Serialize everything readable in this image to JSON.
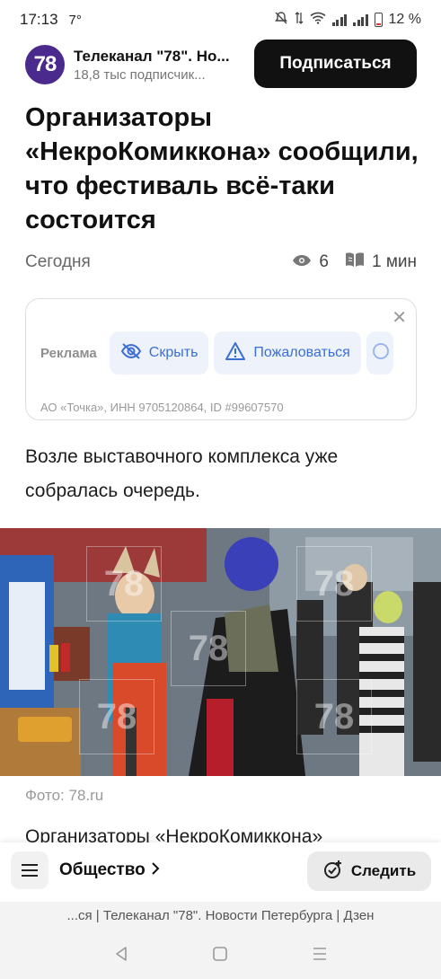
{
  "status_bar": {
    "time": "17:13",
    "temperature": "7°",
    "battery": "12 %"
  },
  "channel": {
    "logo_text": "78",
    "name": "Телеканал \"78\". Но...",
    "subscribers": "18,8 тыс подписчик...",
    "subscribe_label": "Подписаться"
  },
  "article": {
    "title": "Организаторы «НекроКомиккона» сообщили, что фестиваль всё-таки состоится",
    "date": "Сегодня",
    "views": "6",
    "read_time": "1 мин",
    "paragraph1": "Возле выставочного комплекса уже собралась очередь.",
    "photo_caption": "Фото: 78.ru",
    "paragraph2_cut": "Организаторы «НекроКомиккона»",
    "watermark": "78"
  },
  "ad": {
    "label": "Реклама",
    "hide_label": "Скрыть",
    "report_label": "Пожаловаться",
    "legal": "АО «Точка», ИНН 9705120864, ID #99607570",
    "close_glyph": "✕"
  },
  "bottom_bar": {
    "rubric": "Общество",
    "follow_label": "Следить"
  },
  "url_bar": {
    "text": "...ся | Телеканал \"78\". Новости Петербурга | Дзен"
  },
  "colors": {
    "logo_bg": "#4a2a8c",
    "ad_accent": "#3b6fd6",
    "subscribe_bg": "#111111"
  }
}
